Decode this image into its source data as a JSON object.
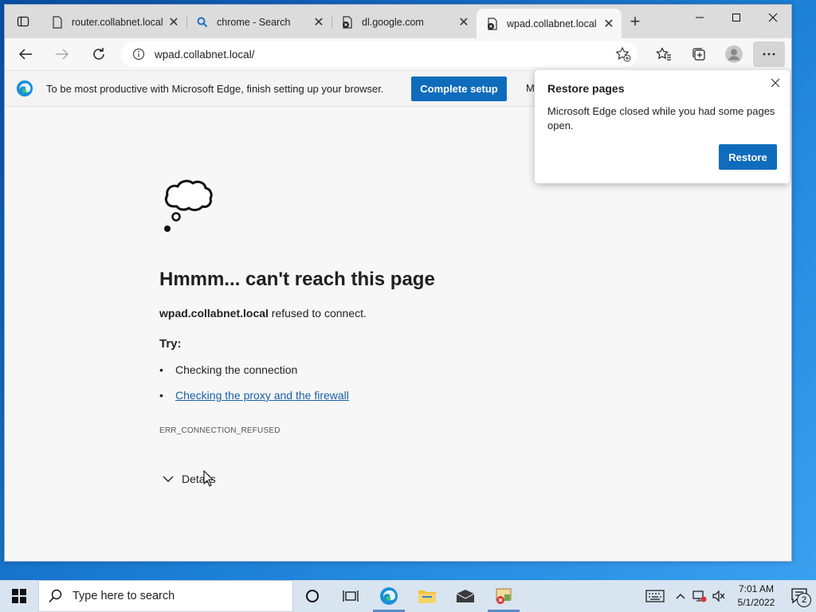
{
  "browser": {
    "tabs": [
      {
        "title": "router.collabnet.local",
        "icon": "page-icon",
        "active": false
      },
      {
        "title": "chrome - Search",
        "icon": "search-icon",
        "active": false
      },
      {
        "title": "dl.google.com",
        "icon": "page-error-icon",
        "active": false
      },
      {
        "title": "wpad.collabnet.local",
        "icon": "page-error-icon",
        "active": true
      }
    ],
    "address_url": "wpad.collabnet.local/"
  },
  "setup_bar": {
    "message": "To be most productive with Microsoft Edge, finish setting up your browser.",
    "primary_label": "Complete setup",
    "secondary_label": "M"
  },
  "error_page": {
    "title": "Hmmm... can't reach this page",
    "host": "wpad.collabnet.local",
    "host_suffix": " refused to connect.",
    "try_label": "Try:",
    "suggestions": [
      {
        "text": "Checking the connection",
        "link": false
      },
      {
        "text": "Checking the proxy and the firewall",
        "link": true
      }
    ],
    "error_code": "ERR_CONNECTION_REFUSED",
    "details_label": "Details"
  },
  "restore_popup": {
    "title": "Restore pages",
    "message": "Microsoft Edge closed while you had some pages open.",
    "button_label": "Restore"
  },
  "taskbar": {
    "search_placeholder": "Type here to search",
    "time": "7:01 AM",
    "date": "5/1/2022",
    "notification_count": "2"
  },
  "colors": {
    "accent": "#0f6cbd",
    "link": "#1a5fa8"
  }
}
